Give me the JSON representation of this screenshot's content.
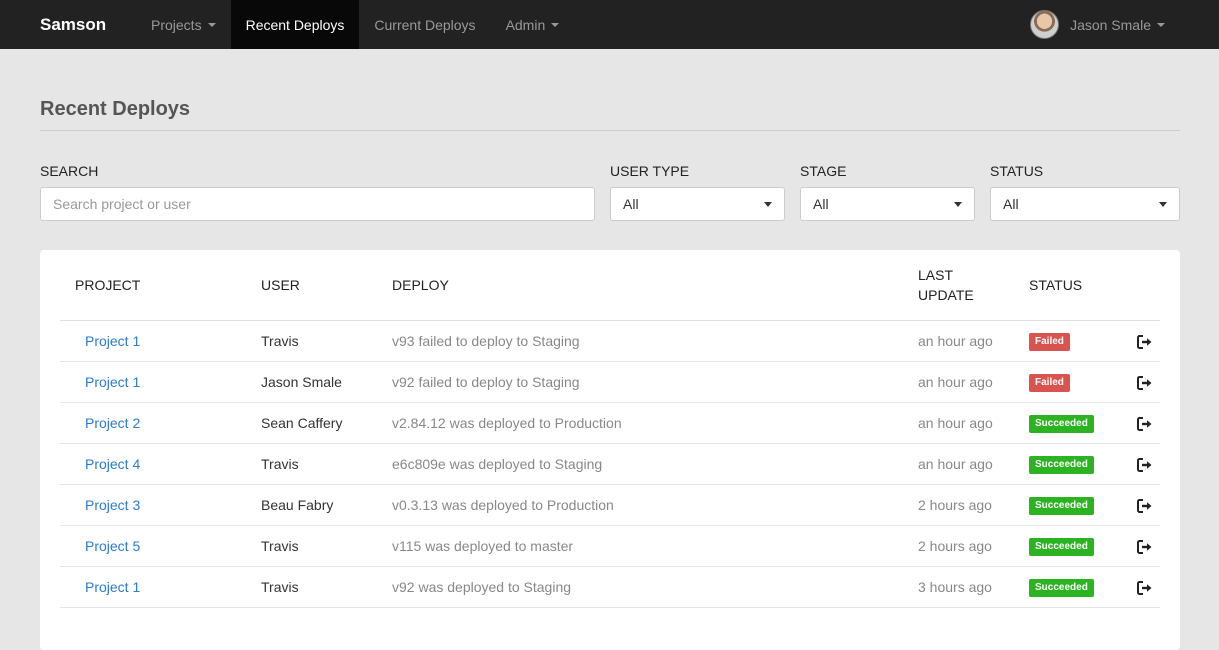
{
  "nav": {
    "brand": "Samson",
    "items": [
      {
        "label": "Projects"
      },
      {
        "label": "Recent Deploys"
      },
      {
        "label": "Current Deploys"
      },
      {
        "label": "Admin"
      }
    ],
    "user_name": "Jason Smale"
  },
  "page": {
    "title": "Recent Deploys"
  },
  "filters": {
    "search_label": "SEARCH",
    "search_placeholder": "Search project or user",
    "user_type_label": "USER TYPE",
    "user_type_value": "All",
    "stage_label": "STAGE",
    "stage_value": "All",
    "status_label": "STATUS",
    "status_value": "All"
  },
  "table": {
    "headers": {
      "project": "PROJECT",
      "user": "USER",
      "deploy": "DEPLOY",
      "last_update_1": "LAST",
      "last_update_2": "UPDATE",
      "status": "STATUS"
    },
    "rows": [
      {
        "project": "Project 1",
        "user": "Travis",
        "deploy": "v93 failed to deploy to Staging",
        "updated": "an hour ago",
        "status": "Failed"
      },
      {
        "project": "Project 1",
        "user": "Jason Smale",
        "deploy": "v92 failed to deploy to Staging",
        "updated": "an hour ago",
        "status": "Failed"
      },
      {
        "project": "Project 2",
        "user": "Sean Caffery",
        "deploy": "v2.84.12 was deployed to Production",
        "updated": "an hour ago",
        "status": "Succeeded"
      },
      {
        "project": "Project 4",
        "user": "Travis",
        "deploy": "e6c809e was deployed to Staging",
        "updated": "an hour ago",
        "status": "Succeeded"
      },
      {
        "project": "Project 3",
        "user": "Beau Fabry",
        "deploy": "v0.3.13 was deployed to Production",
        "updated": "2 hours ago",
        "status": "Succeeded"
      },
      {
        "project": "Project 5",
        "user": "Travis",
        "deploy": "v115 was deployed to master",
        "updated": "2 hours ago",
        "status": "Succeeded"
      },
      {
        "project": "Project 1",
        "user": "Travis",
        "deploy": "v92 was deployed to Staging",
        "updated": "3 hours ago",
        "status": "Succeeded"
      }
    ]
  },
  "colors": {
    "failed": "#d9534f",
    "succeeded": "#2cb322",
    "link": "#2a7bd1",
    "navbar": "#222222"
  },
  "icons": {
    "row_action": "sign-out-icon",
    "dropdown": "caret-down-icon"
  }
}
